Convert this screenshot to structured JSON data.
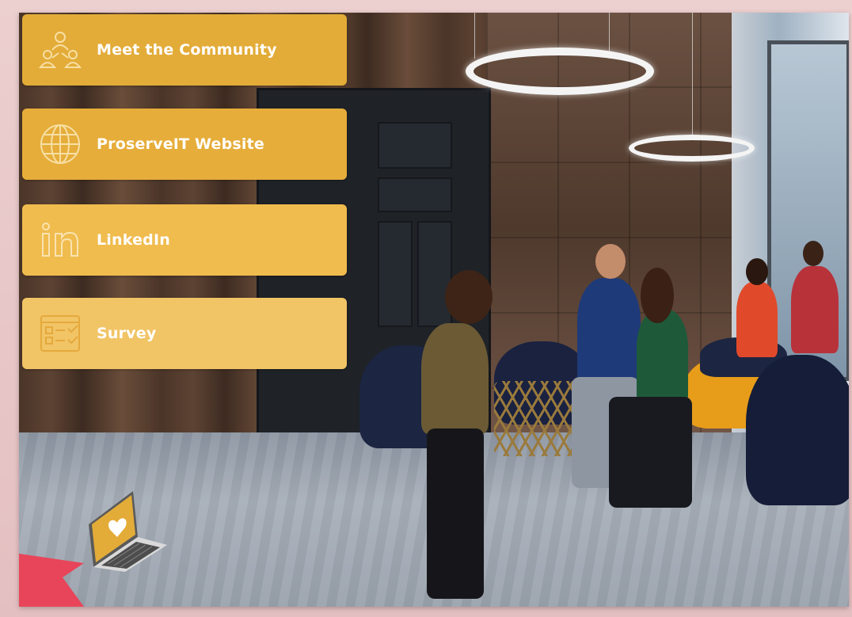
{
  "menu": {
    "items": [
      {
        "label": "Meet the Community",
        "icon": "community-icon"
      },
      {
        "label": "ProserveIT Website",
        "icon": "globe-icon"
      },
      {
        "label": "LinkedIn",
        "icon": "linkedin-icon"
      },
      {
        "label": "Survey",
        "icon": "survey-icon"
      }
    ]
  },
  "colors": {
    "button_primary": "#e3ac38",
    "button_light": "#f1c466",
    "accent_arrow": "#e8455a",
    "laptop_screen": "#e3ac38"
  },
  "scene": {
    "background": "lobby-scene",
    "laptop_icon": "laptop-heart-icon",
    "arrow_icon": "arrow-pointer-icon"
  }
}
